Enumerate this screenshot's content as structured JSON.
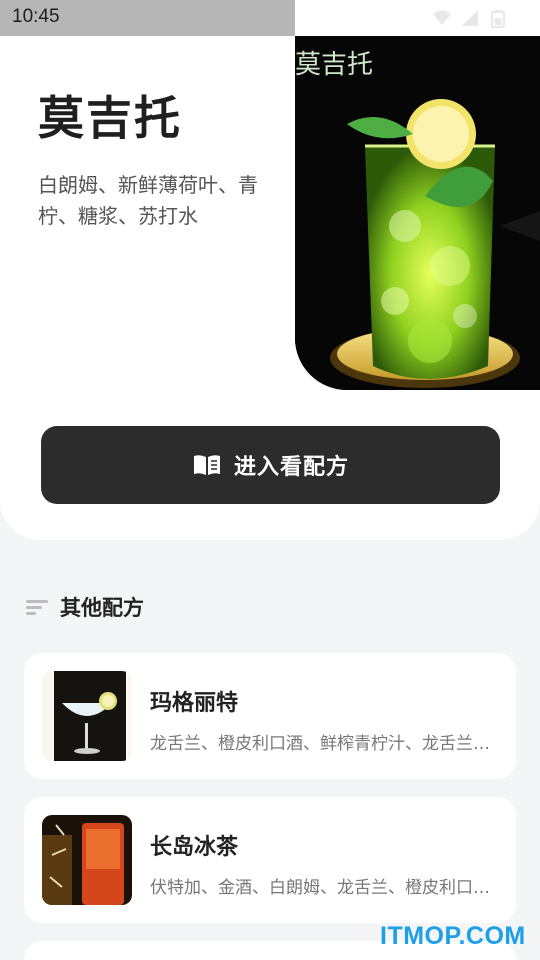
{
  "status_bar": {
    "time": "10:45",
    "icons": [
      "wifi-icon",
      "signal-icon",
      "battery-icon"
    ]
  },
  "hero": {
    "image_caption": "莫吉托",
    "name": "莫吉托",
    "ingredients": "白朗姆、新鲜薄荷叶、青柠、糖浆、苏打水",
    "button_label": "进入看配方",
    "button_icon": "book-icon"
  },
  "section": {
    "title": "其他配方",
    "icon": "sort-lines-icon"
  },
  "recipes": [
    {
      "name": "玛格丽特",
      "ingredients": "龙舌兰、橙皮利口酒、鲜榨青柠汁、龙舌兰糖浆、盐"
    },
    {
      "name": "长岛冰茶",
      "ingredients": "伏特加、金酒、白朗姆、龙舌兰、橙皮利口酒、柠檬汁、可乐"
    }
  ],
  "watermark": "ITMOP.COM",
  "colors": {
    "button_bg": "#2c2c2c",
    "page_bg": "#f4f5f7",
    "watermark": "#1ea0e8"
  }
}
